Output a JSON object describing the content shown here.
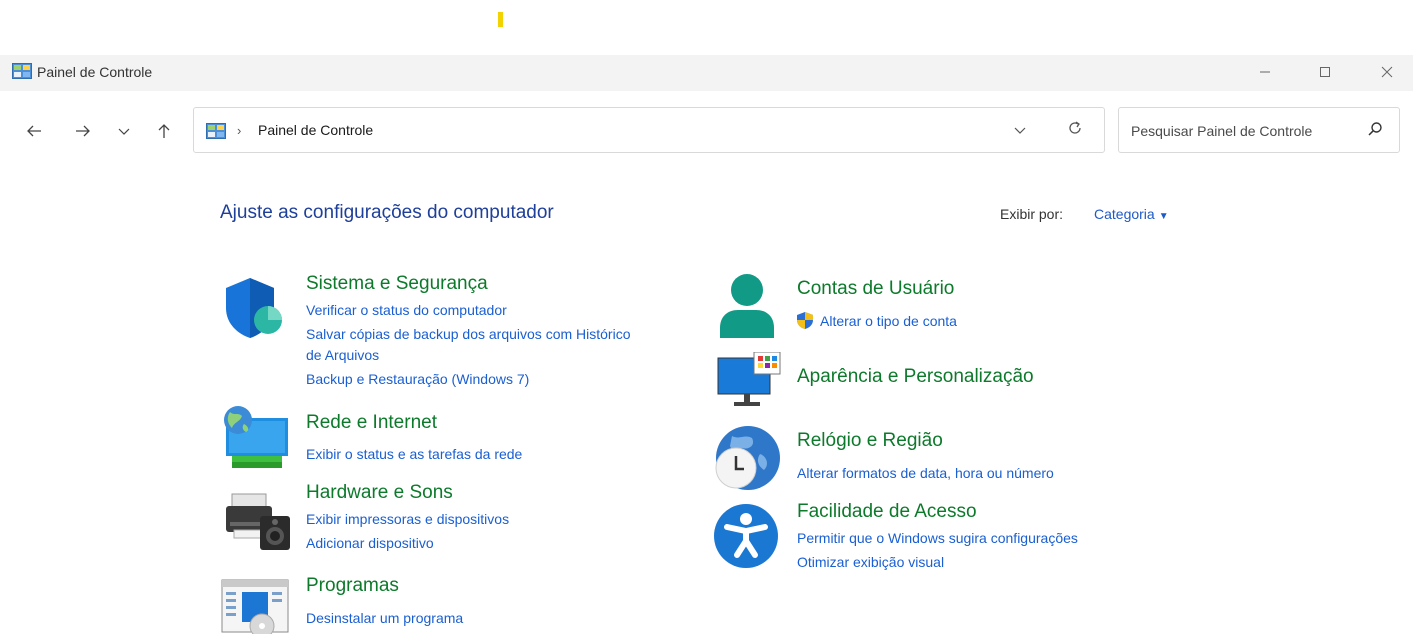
{
  "window": {
    "title": "Painel de Controle"
  },
  "address": {
    "separator": "›",
    "crumb": "Painel de Controle"
  },
  "search": {
    "placeholder": "Pesquisar Painel de Controle"
  },
  "content": {
    "heading": "Ajuste as configurações do computador",
    "view_by_label": "Exibir por:",
    "view_by_value": "Categoria"
  },
  "categories": {
    "sistema": {
      "title": "Sistema e Segurança",
      "links": [
        "Verificar o status do computador",
        "Salvar cópias de backup dos arquivos com Histórico",
        "de Arquivos",
        "Backup e Restauração (Windows 7)"
      ]
    },
    "rede": {
      "title": "Rede e Internet",
      "links": [
        "Exibir o status e as tarefas da rede"
      ]
    },
    "hardware": {
      "title": "Hardware e Sons",
      "links": [
        "Exibir impressoras e dispositivos",
        "Adicionar dispositivo"
      ]
    },
    "programas": {
      "title": "Programas",
      "links": [
        "Desinstalar um programa"
      ]
    },
    "contas": {
      "title": "Contas de Usuário",
      "links": [
        "Alterar o tipo de conta"
      ]
    },
    "aparencia": {
      "title": "Aparência e Personalização",
      "links": []
    },
    "relogio": {
      "title": "Relógio e Região",
      "links": [
        "Alterar formatos de data, hora ou número"
      ]
    },
    "facilidade": {
      "title": "Facilidade de Acesso",
      "links": [
        "Permitir que o Windows sugira configurações",
        "Otimizar exibição visual"
      ]
    }
  },
  "colors": {
    "category_title": "#0d7a2b",
    "link": "#1a5fd1",
    "heading": "#1e3f9a"
  },
  "icons": {
    "nav": [
      "back-arrow-icon",
      "forward-arrow-icon",
      "recent-dropdown-icon",
      "up-arrow-icon"
    ]
  }
}
